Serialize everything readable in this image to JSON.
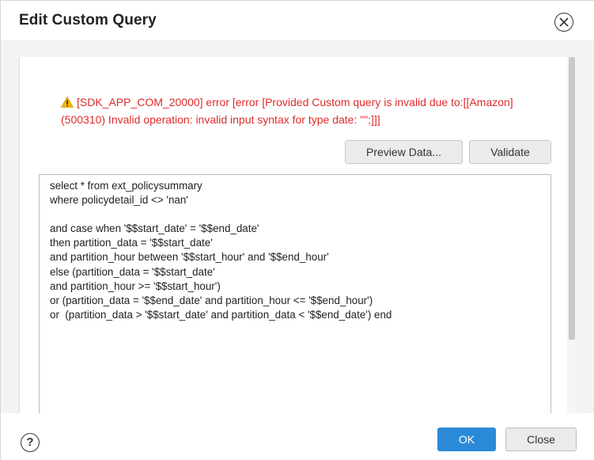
{
  "dialog": {
    "title": "Edit Custom Query",
    "close_icon": "close-circle-icon"
  },
  "error": {
    "icon": "warning-triangle-icon",
    "line1": "[SDK_APP_COM_20000] error [error [Provided Custom query is invalid due to:[[Amazon]",
    "line2": "(500310) Invalid operation: invalid input syntax for type date: \"\";]]]",
    "color": "#e02b2b"
  },
  "actions": {
    "preview_label": "Preview Data...",
    "validate_label": "Validate"
  },
  "query": {
    "text": "select * from ext_policysummary\nwhere policydetail_id <> 'nan'\n\nand case when '$$start_date' = '$$end_date'\nthen partition_data = '$$start_date'\nand partition_hour between '$$start_hour' and '$$end_hour'\nelse (partition_data = '$$start_date'\nand partition_hour >= '$$start_hour')\nor (partition_data = '$$end_date' and partition_hour <= '$$end_hour')\nor  (partition_data > '$$start_date' and partition_data < '$$end_date') end"
  },
  "footer": {
    "help_icon": "help-circle-icon",
    "help_glyph": "?",
    "ok_label": "OK",
    "close_label": "Close",
    "accent": "#2b8ad8"
  }
}
